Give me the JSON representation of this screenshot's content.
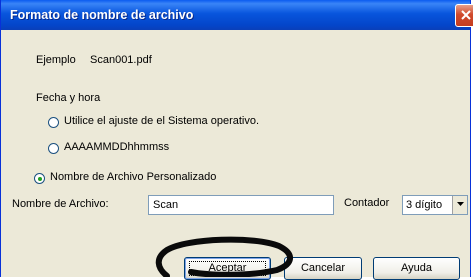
{
  "dialog": {
    "title": "Formato de nombre de archivo"
  },
  "example": {
    "label": "Ejemplo",
    "value": "Scan001.pdf"
  },
  "date_group": {
    "label": "Fecha y hora",
    "options": [
      {
        "label": "Utilice el ajuste de el Sistema operativo.",
        "selected": false
      },
      {
        "label": "AAAAMMDDhhmmss",
        "selected": false
      }
    ]
  },
  "custom": {
    "label": "Nombre de Archivo Personalizado",
    "selected": true,
    "filename_label": "Nombre de Archivo:",
    "filename_value": "Scan",
    "counter_label": "Contador",
    "counter_value": "3 dígito"
  },
  "buttons": {
    "ok": "Aceptar",
    "cancel": "Cancelar",
    "help": "Ayuda"
  },
  "colors": {
    "titlebar": "#0855dd",
    "dialog_bg": "#ece9d8",
    "radio_dot": "#21a121",
    "close_button": "#d04a2c"
  }
}
